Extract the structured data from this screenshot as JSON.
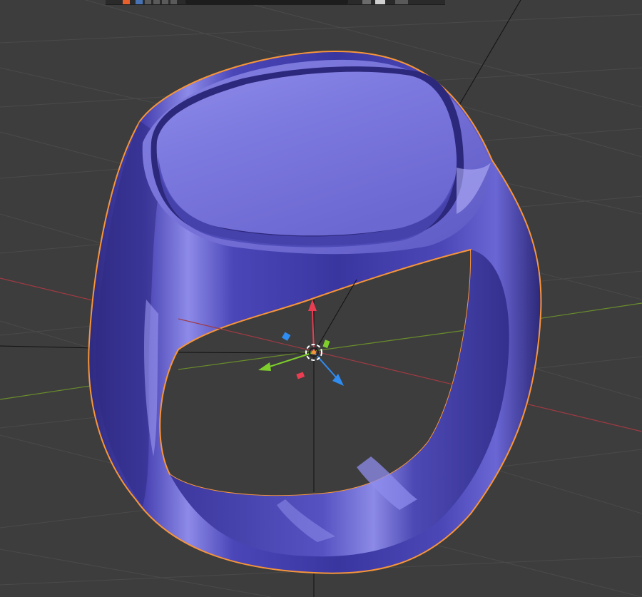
{
  "app": {
    "editor": "3D Viewport",
    "selected_object": "signet-ring"
  },
  "header": {
    "editor_type_icon": "editor-type-icon",
    "select_mode_icon": "select-box-icon",
    "mode_icons": [
      "selection-mode-icon",
      "overlay-icon",
      "shading-icon",
      "xray-icon"
    ],
    "search_icon": "search-field-icon",
    "right_icons": [
      "gizmo-toggle-icon",
      "overlay-toggle-icon",
      "viewport-shading-icon"
    ]
  },
  "colors": {
    "background": "#3d3d3d",
    "grid_line": "#4a4a4a",
    "x_axis": "#a03a43",
    "y_axis": "#6a8e2b",
    "selection_outline": "#f7953a",
    "ring_base": "#5a56c8",
    "ring_shadow": "#312d86",
    "ring_highlight": "#9c9cf2",
    "gizmo_x": "#ea3d52",
    "gizmo_y": "#7fcf2c",
    "gizmo_z": "#2f8cf0"
  }
}
